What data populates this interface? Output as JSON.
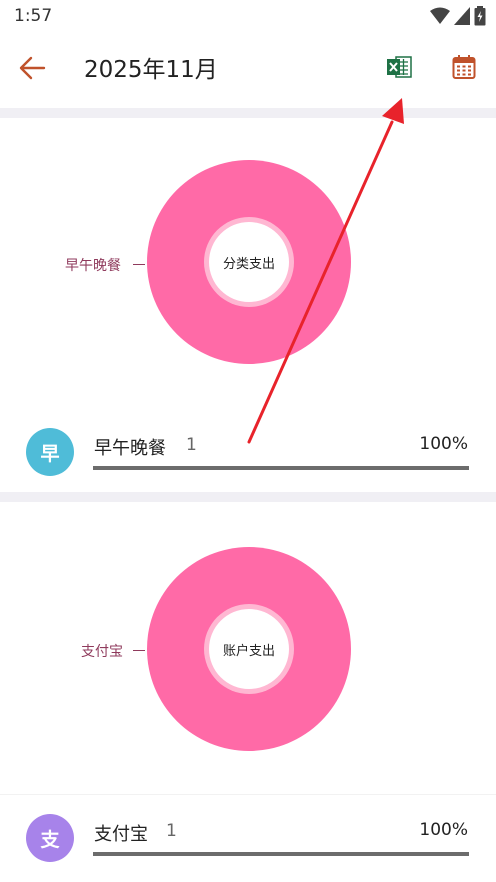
{
  "status_bar": {
    "time": "1:57",
    "icons": [
      "wifi-icon",
      "signal-icon",
      "battery-icon"
    ]
  },
  "app_bar": {
    "title": "2025年11月",
    "back_icon": "arrow-left-icon",
    "actions": [
      "excel-export-icon",
      "calendar-icon"
    ],
    "accent_color": "#c0522b",
    "excel_color": "#1e7145"
  },
  "category_section": {
    "donut_center": "分类支出",
    "slice_label": "早午晚餐",
    "slice_color": "#ff6aa7",
    "row": {
      "avatar": "早",
      "avatar_color": "#4fbcd8",
      "name": "早午晚餐",
      "count": "1",
      "percent": "100%",
      "fraction": 1.0
    }
  },
  "account_section": {
    "donut_center": "账户支出",
    "slice_label": "支付宝",
    "slice_color": "#ff6aa7",
    "row": {
      "avatar": "支",
      "avatar_color": "#a783ea",
      "name": "支付宝",
      "count": "1",
      "percent": "100%",
      "fraction": 1.0
    }
  }
}
